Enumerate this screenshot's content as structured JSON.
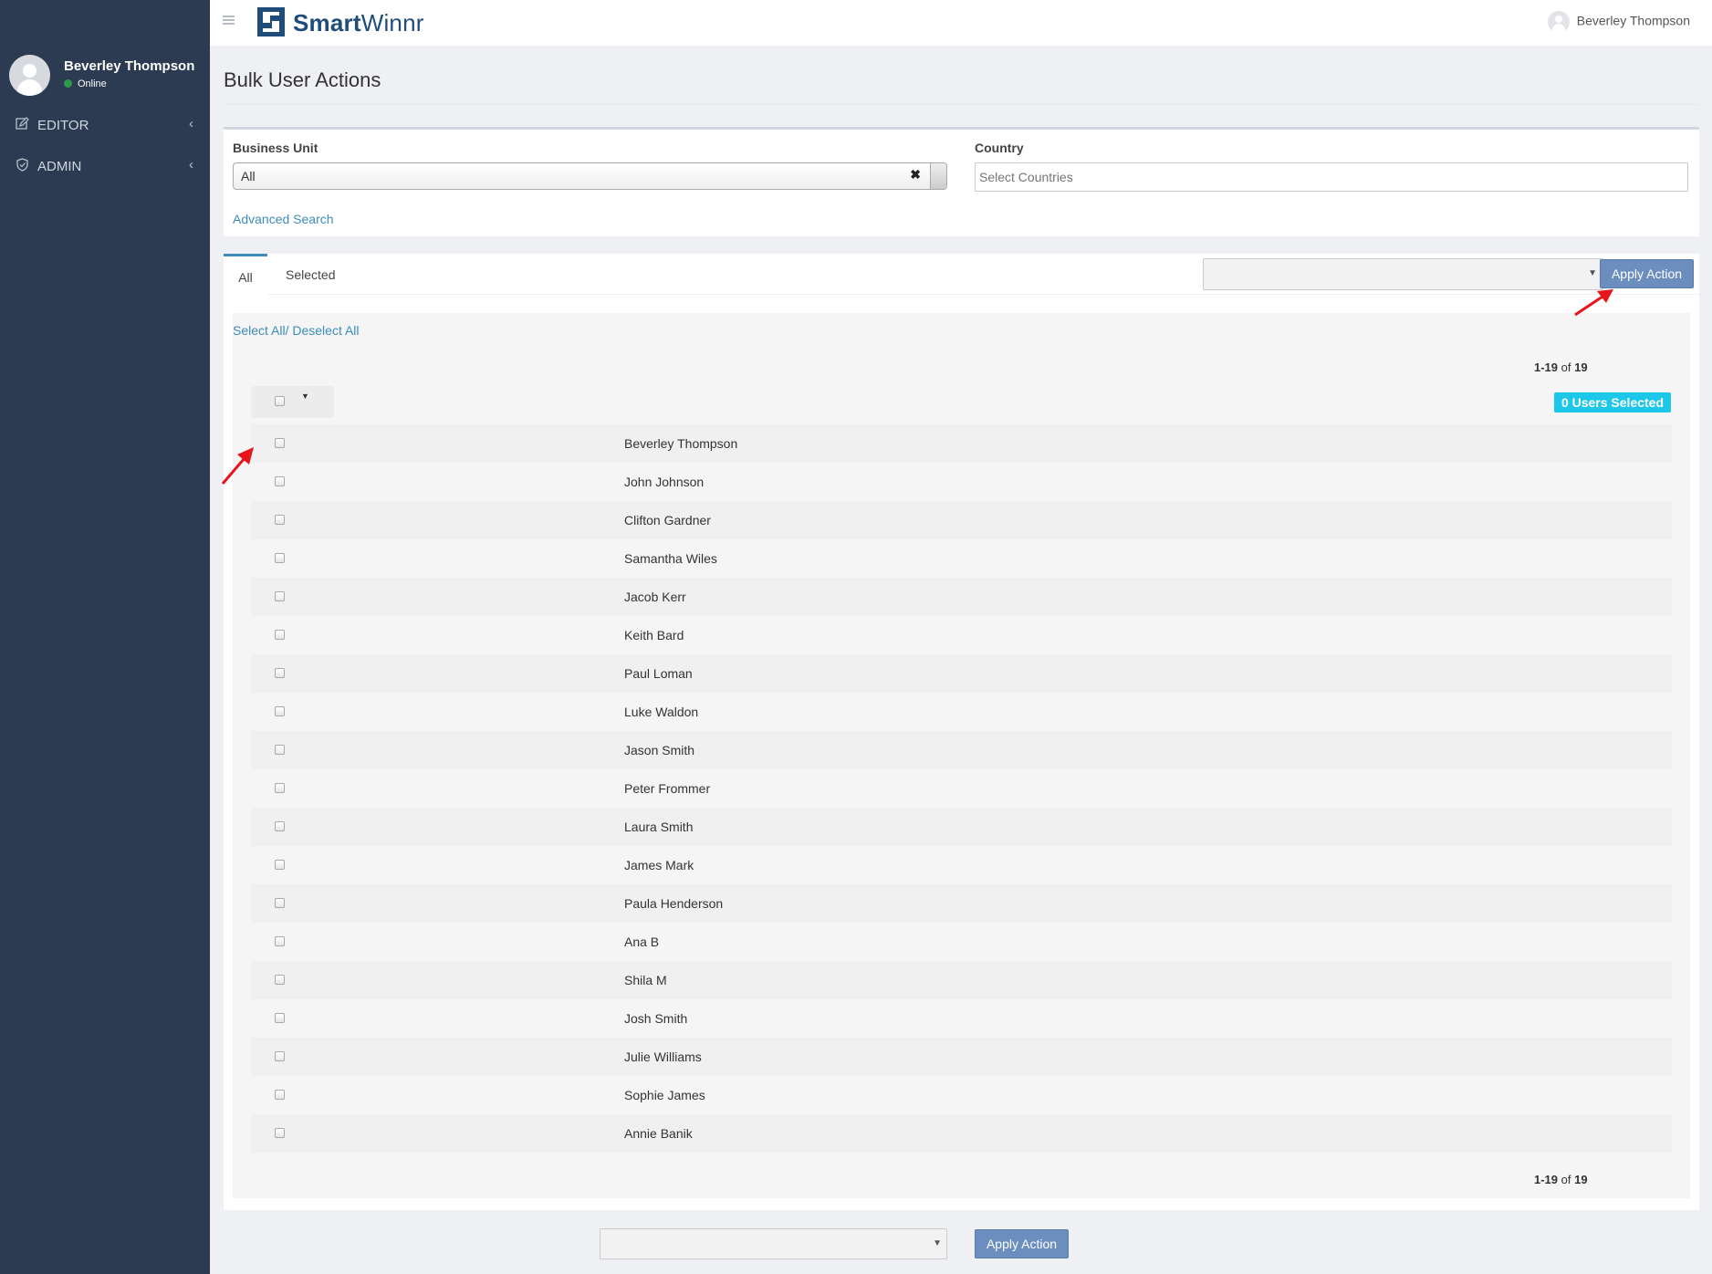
{
  "sidebar": {
    "user_name": "Beverley Thompson",
    "user_status": "Online",
    "items": [
      {
        "label": "EDITOR",
        "icon": "edit-icon"
      },
      {
        "label": "ADMIN",
        "icon": "shield-icon"
      }
    ]
  },
  "header": {
    "logo_text_bold": "Smart",
    "logo_text_rest": "Winnr",
    "user_name": "Beverley Thompson"
  },
  "page": {
    "title": "Bulk User Actions"
  },
  "filters": {
    "business_unit_label": "Business Unit",
    "business_unit_value": "All",
    "business_unit_clear": "✖",
    "country_label": "Country",
    "country_placeholder": "Select Countries",
    "advanced_search": "Advanced Search"
  },
  "tabs": [
    {
      "label": "All",
      "active": true
    },
    {
      "label": "Selected",
      "active": false
    }
  ],
  "actions": {
    "apply_label": "Apply Action",
    "select_value": ""
  },
  "list": {
    "select_all": "Select All",
    "separator": "/",
    "deselect_all": " Deselect All",
    "range": "1-19",
    "of": "of",
    "total": "19",
    "selected_badge": "0 Users Selected",
    "users": [
      "Beverley Thompson",
      "John Johnson",
      "Clifton Gardner",
      "Samantha Wiles",
      "Jacob Kerr",
      "Keith Bard",
      "Paul Loman",
      "Luke Waldon",
      "Jason Smith",
      "Peter Frommer",
      "Laura Smith",
      "James Mark",
      "Paula Henderson",
      "Ana B",
      "Shila M",
      "Josh Smith",
      "Julie Williams",
      "Sophie James",
      "Annie Banik"
    ]
  },
  "colors": {
    "sidebar_bg": "#2c3b52",
    "link": "#3c8dbc",
    "button": "#6c8ebf",
    "badge": "#1cc7ea",
    "annotation_arrow": "#e8141c"
  }
}
